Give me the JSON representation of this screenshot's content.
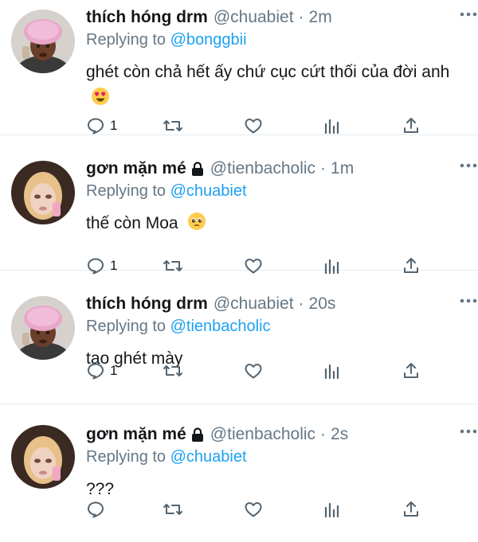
{
  "tweets": [
    {
      "name": "thích hóng drm",
      "handle": "@chuabiet",
      "time": "2m",
      "locked": false,
      "avatar": "pink-shower-cap-avatar",
      "reply_prefix": "Replying to",
      "reply_to": "@bonggbii",
      "text": "ghét còn chả hết ấy chứ cục cứt thối của đời anh",
      "emoji": "heart-eyes-emoji",
      "reply_count": "1"
    },
    {
      "name": "gơn mặn mé",
      "handle": "@tienbacholic",
      "time": "1m",
      "locked": true,
      "avatar": "bratz-doll-avatar",
      "reply_prefix": "Replying to",
      "reply_to": "@chuabiet",
      "text": "thế còn Moa",
      "emoji": "pleading-face-emoji",
      "reply_count": "1"
    },
    {
      "name": "thích hóng drm",
      "handle": "@chuabiet",
      "time": "20s",
      "locked": false,
      "avatar": "pink-shower-cap-avatar",
      "reply_prefix": "Replying to",
      "reply_to": "@tienbacholic",
      "text": "tao ghét mày",
      "emoji": "",
      "reply_count": "1"
    },
    {
      "name": "gơn mặn mé",
      "handle": "@tienbacholic",
      "time": "2s",
      "locked": true,
      "avatar": "bratz-doll-avatar",
      "reply_prefix": "Replying to",
      "reply_to": "@chuabiet",
      "text": "???",
      "emoji": "",
      "reply_count": ""
    }
  ],
  "separator": "·",
  "colors": {
    "link": "#1da1f2",
    "secondary_text": "#657786",
    "icon": "#536471"
  }
}
